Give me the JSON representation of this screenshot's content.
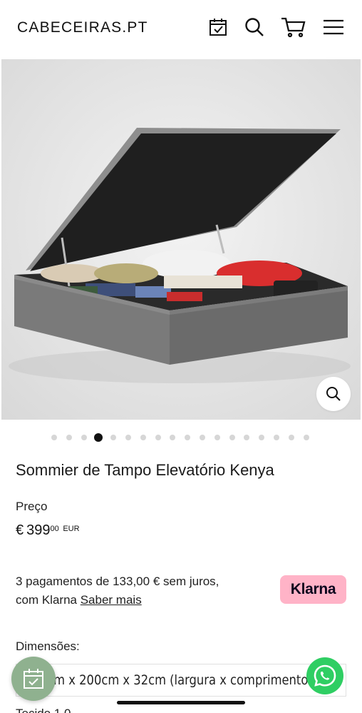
{
  "header": {
    "logo": "CABECEIRAS.PT",
    "icons": [
      "calendar-check-icon",
      "search-icon",
      "cart-icon",
      "menu-icon"
    ]
  },
  "gallery": {
    "slide_count": 18,
    "active_slide": 4,
    "zoom_icon": "zoom-icon"
  },
  "product": {
    "title": "Sommier de Tampo Elevatório Kenya",
    "price_label": "Preço",
    "price_currency": "€",
    "price_main": "399",
    "price_cents": "00",
    "price_code": "EUR"
  },
  "klarna": {
    "text_line1": "3 pagamentos de 133,00 € sem juros,",
    "text_line2": "com Klarna",
    "link": "Saber mais",
    "badge": "Klarna"
  },
  "dimensions": {
    "label": "Dimensões:",
    "selected": "150cm x 200cm x 32cm (largura x comprimento x a"
  },
  "below_fold": {
    "partial_text": "Tecido 1.0"
  },
  "colors": {
    "klarna_pink": "#ffb3c7",
    "calendar_green": "#8fb18f",
    "whatsapp_green": "#2fce63"
  }
}
